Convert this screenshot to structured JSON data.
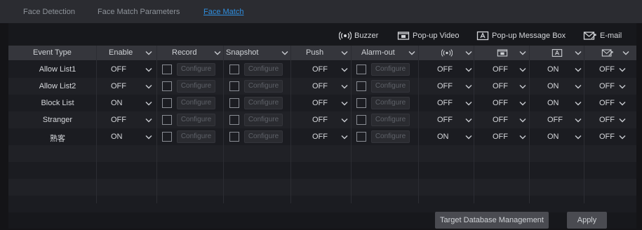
{
  "tabs": [
    {
      "label": "Face Detection",
      "active": false
    },
    {
      "label": "Face Match Parameters",
      "active": false
    },
    {
      "label": "Face Match",
      "active": true
    }
  ],
  "legend": {
    "buzzer": "Buzzer",
    "popup_video": "Pop-up Video",
    "popup_message_box": "Pop-up Message Box",
    "email": "E-mail"
  },
  "columns": {
    "event_type": "Event Type",
    "enable": "Enable",
    "record": "Record",
    "snapshot": "Snapshot",
    "push": "Push",
    "alarm_out": "Alarm-out"
  },
  "configure_label": "Configure",
  "rows": [
    {
      "event": "Allow List1",
      "enable": "OFF",
      "record": false,
      "snapshot": false,
      "push": "OFF",
      "alarm_out": false,
      "buzzer": "OFF",
      "popup_video": "OFF",
      "popup_message": "ON",
      "email": "OFF"
    },
    {
      "event": "Allow List2",
      "enable": "OFF",
      "record": false,
      "snapshot": false,
      "push": "OFF",
      "alarm_out": false,
      "buzzer": "OFF",
      "popup_video": "OFF",
      "popup_message": "ON",
      "email": "OFF"
    },
    {
      "event": "Block List",
      "enable": "ON",
      "record": false,
      "snapshot": false,
      "push": "OFF",
      "alarm_out": false,
      "buzzer": "OFF",
      "popup_video": "OFF",
      "popup_message": "ON",
      "email": "OFF"
    },
    {
      "event": "Stranger",
      "enable": "OFF",
      "record": false,
      "snapshot": false,
      "push": "OFF",
      "alarm_out": false,
      "buzzer": "OFF",
      "popup_video": "OFF",
      "popup_message": "OFF",
      "email": "OFF"
    },
    {
      "event": "熟客",
      "enable": "ON",
      "record": false,
      "snapshot": false,
      "push": "OFF",
      "alarm_out": false,
      "buzzer": "ON",
      "popup_video": "OFF",
      "popup_message": "ON",
      "email": "OFF"
    }
  ],
  "buttons": {
    "target_db": "Target Database Management",
    "apply": "Apply"
  },
  "colors": {
    "accent": "#2f8fe0",
    "background": "#141417",
    "header": "#35363c"
  },
  "icons": {
    "buzzer": "buzzer-icon",
    "popup_video": "popup-video-icon",
    "popup_message": "popup-message-icon",
    "email": "email-icon",
    "dropdown": "chevron-down-icon"
  }
}
